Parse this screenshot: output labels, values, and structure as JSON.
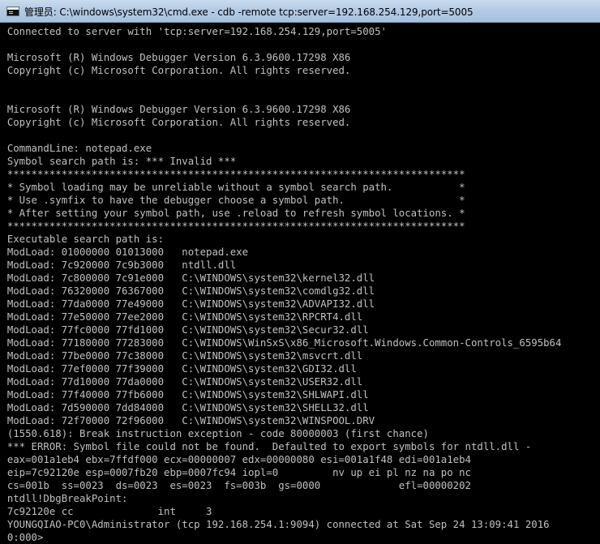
{
  "window": {
    "title": "管理员: C:\\windows\\system32\\cmd.exe - cdb  -remote tcp:server=192.168.254.129,port=5005"
  },
  "console": {
    "lines": [
      "Connected to server with 'tcp:server=192.168.254.129,port=5005'",
      "",
      "Microsoft (R) Windows Debugger Version 6.3.9600.17298 X86",
      "Copyright (c) Microsoft Corporation. All rights reserved.",
      "",
      "",
      "Microsoft (R) Windows Debugger Version 6.3.9600.17298 X86",
      "Copyright (c) Microsoft Corporation. All rights reserved.",
      "",
      "CommandLine: notepad.exe",
      "Symbol search path is: *** Invalid ***",
      "****************************************************************************",
      "* Symbol loading may be unreliable without a symbol search path.           *",
      "* Use .symfix to have the debugger choose a symbol path.                   *",
      "* After setting your symbol path, use .reload to refresh symbol locations. *",
      "****************************************************************************",
      "Executable search path is:",
      "ModLoad: 01000000 01013000   notepad.exe",
      "ModLoad: 7c920000 7c9b3000   ntdll.dll",
      "ModLoad: 7c800000 7c91e000   C:\\WINDOWS\\system32\\kernel32.dll",
      "ModLoad: 76320000 76367000   C:\\WINDOWS\\system32\\comdlg32.dll",
      "ModLoad: 77da0000 77e49000   C:\\WINDOWS\\system32\\ADVAPI32.dll",
      "ModLoad: 77e50000 77ee2000   C:\\WINDOWS\\system32\\RPCRT4.dll",
      "ModLoad: 77fc0000 77fd1000   C:\\WINDOWS\\system32\\Secur32.dll",
      "ModLoad: 77180000 77283000   C:\\WINDOWS\\WinSxS\\x86_Microsoft.Windows.Common-Controls_6595b64",
      "ModLoad: 77be0000 77c38000   C:\\WINDOWS\\system32\\msvcrt.dll",
      "ModLoad: 77ef0000 77f39000   C:\\WINDOWS\\system32\\GDI32.dll",
      "ModLoad: 77d10000 77da0000   C:\\WINDOWS\\system32\\USER32.dll",
      "ModLoad: 77f40000 77fb6000   C:\\WINDOWS\\system32\\SHLWAPI.dll",
      "ModLoad: 7d590000 7dd84000   C:\\WINDOWS\\system32\\SHELL32.dll",
      "ModLoad: 72f70000 72f96000   C:\\WINDOWS\\system32\\WINSPOOL.DRV",
      "(1550.618): Break instruction exception - code 80000003 (first chance)",
      "*** ERROR: Symbol file could not be found.  Defaulted to export symbols for ntdll.dll -",
      "eax=001a1eb4 ebx=7ffdf000 ecx=00000007 edx=00000080 esi=001a1f48 edi=001a1eb4",
      "eip=7c92120e esp=0007fb20 ebp=0007fc94 iopl=0         nv up ei pl nz na po nc",
      "cs=001b  ss=0023  ds=0023  es=0023  fs=003b  gs=0000             efl=00000202",
      "ntdll!DbgBreakPoint:",
      "7c92120e cc              int     3",
      "YOUNGQIAO-PC0\\Administrator (tcp 192.168.254.1:9094) connected at Sat Sep 24 13:09:41 2016",
      "0:000>"
    ]
  }
}
